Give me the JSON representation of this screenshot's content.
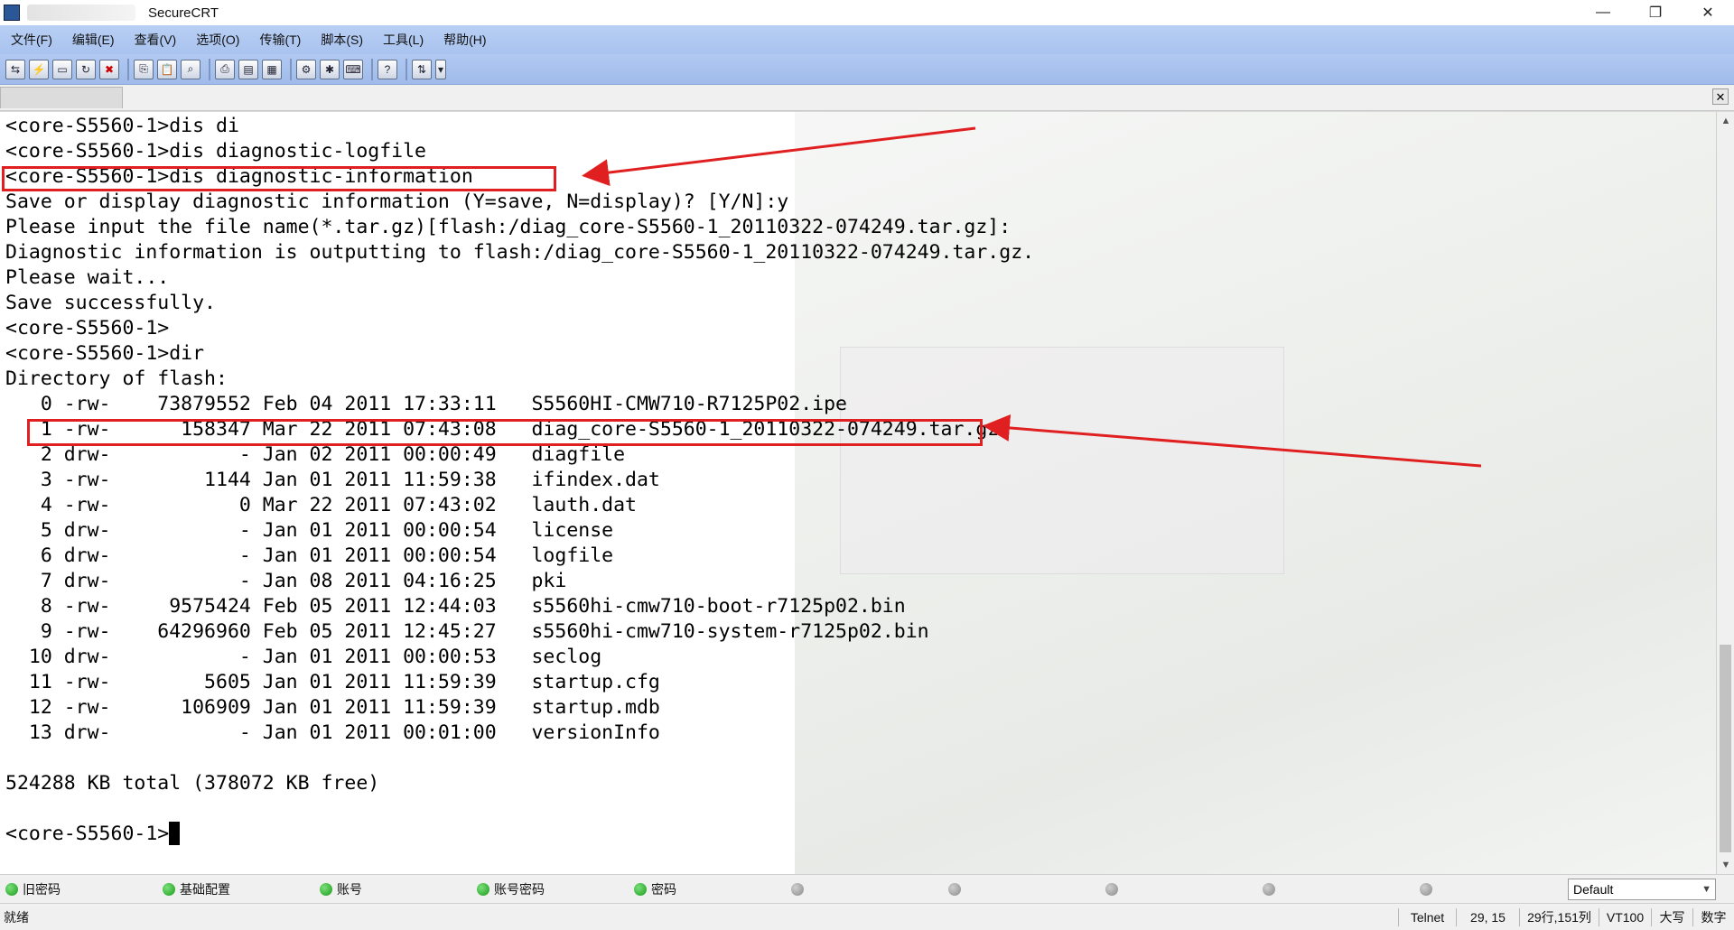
{
  "window": {
    "title": "SecureCRT",
    "controls": {
      "minimize": "—",
      "restore": "❐",
      "close": "✕"
    }
  },
  "menu": [
    "文件(F)",
    "编辑(E)",
    "查看(V)",
    "选项(O)",
    "传输(T)",
    "脚本(S)",
    "工具(L)",
    "帮助(H)"
  ],
  "toolbar_icons": [
    "connect-icon",
    "quick-connect-icon",
    "connect-in-tab-icon",
    "reconnect-icon",
    "disconnect-icon",
    "copy-icon",
    "paste-icon",
    "find-icon",
    "print-icon",
    "print-selection-icon",
    "print-setup-icon",
    "session-options-icon",
    "global-options-icon",
    "keymap-icon",
    "help-icon",
    "sftp-icon"
  ],
  "tab": {
    "close_glyph": "✕"
  },
  "terminal": {
    "lines": [
      "<core-S5560-1>dis di",
      "<core-S5560-1>dis diagnostic-logfile",
      "<core-S5560-1>dis diagnostic-information",
      "Save or display diagnostic information (Y=save, N=display)? [Y/N]:y",
      "Please input the file name(*.tar.gz)[flash:/diag_core-S5560-1_20110322-074249.tar.gz]:",
      "Diagnostic information is outputting to flash:/diag_core-S5560-1_20110322-074249.tar.gz.",
      "Please wait...",
      "Save successfully.",
      "<core-S5560-1>",
      "<core-S5560-1>dir",
      "Directory of flash:",
      "   0 -rw-    73879552 Feb 04 2011 17:33:11   S5560HI-CMW710-R7125P02.ipe",
      "   1 -rw-      158347 Mar 22 2011 07:43:08   diag_core-S5560-1_20110322-074249.tar.gz",
      "   2 drw-           - Jan 02 2011 00:00:49   diagfile",
      "   3 -rw-        1144 Jan 01 2011 11:59:38   ifindex.dat",
      "   4 -rw-           0 Mar 22 2011 07:43:02   lauth.dat",
      "   5 drw-           - Jan 01 2011 00:00:54   license",
      "   6 drw-           - Jan 01 2011 00:00:54   logfile",
      "   7 drw-           - Jan 08 2011 04:16:25   pki",
      "   8 -rw-     9575424 Feb 05 2011 12:44:03   s5560hi-cmw710-boot-r7125p02.bin",
      "   9 -rw-    64296960 Feb 05 2011 12:45:27   s5560hi-cmw710-system-r7125p02.bin",
      "  10 drw-           - Jan 01 2011 00:00:53   seclog",
      "  11 -rw-        5605 Jan 01 2011 11:59:39   startup.cfg",
      "  12 -rw-      106909 Jan 01 2011 11:59:39   startup.mdb",
      "  13 drw-           - Jan 01 2011 00:01:00   versionInfo",
      "",
      "524288 KB total (378072 KB free)",
      "",
      "<core-S5560-1>"
    ]
  },
  "scrollbar": {
    "up": "▲",
    "down": "▼"
  },
  "button_bar": {
    "buttons": [
      "旧密码",
      "基础配置",
      "账号",
      "账号密码",
      "密码"
    ],
    "session_select": "Default",
    "select_arrow": "▼"
  },
  "status_bar": {
    "state": "就绪",
    "protocol": "Telnet",
    "cursor_pos": "29, 15",
    "size": "29行,151列",
    "emulation": "VT100",
    "caps": "大写",
    "num": "数字"
  },
  "colors": {
    "highlight": "#e02020",
    "menubar": "#b8cff4",
    "terminal_bg": "#ffffff"
  }
}
